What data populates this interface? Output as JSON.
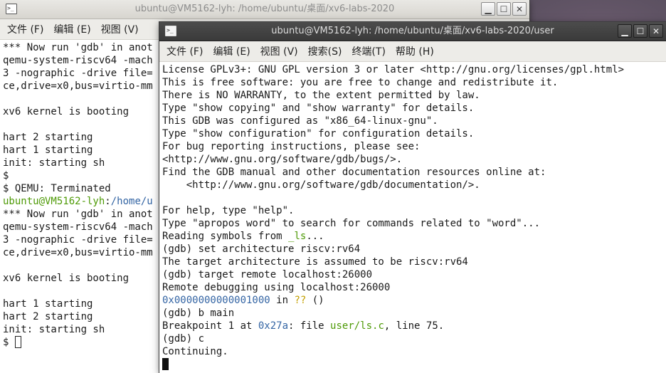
{
  "back_window": {
    "title": "ubuntu@VM5162-lyh: /home/ubuntu/桌面/xv6-labs-2020",
    "menu": [
      "文件 (F)",
      "编辑 (E)",
      "视图 (V)"
    ],
    "lines": [
      [
        {
          "t": "*** Now run 'gdb' in anot"
        }
      ],
      [
        {
          "t": "qemu-system-riscv64 -mach"
        }
      ],
      [
        {
          "t": "3 -nographic -drive file="
        }
      ],
      [
        {
          "t": "ce,drive=x0,bus=virtio-mm"
        }
      ],
      [
        {
          "t": ""
        }
      ],
      [
        {
          "t": "xv6 kernel is booting"
        }
      ],
      [
        {
          "t": ""
        }
      ],
      [
        {
          "t": "hart 2 starting"
        }
      ],
      [
        {
          "t": "hart 1 starting"
        }
      ],
      [
        {
          "t": "init: starting sh"
        }
      ],
      [
        {
          "t": "$"
        }
      ],
      [
        {
          "t": "$ QEMU: Terminated"
        }
      ],
      [
        {
          "t": "ubuntu@VM5162-lyh",
          "c": "green"
        },
        {
          "t": ":"
        },
        {
          "t": "/home/u",
          "c": "blue"
        }
      ],
      [
        {
          "t": "*** Now run 'gdb' in anot"
        }
      ],
      [
        {
          "t": "qemu-system-riscv64 -mach"
        }
      ],
      [
        {
          "t": "3 -nographic -drive file="
        }
      ],
      [
        {
          "t": "ce,drive=x0,bus=virtio-mm"
        }
      ],
      [
        {
          "t": ""
        }
      ],
      [
        {
          "t": "xv6 kernel is booting"
        }
      ],
      [
        {
          "t": ""
        }
      ],
      [
        {
          "t": "hart 1 starting"
        }
      ],
      [
        {
          "t": "hart 2 starting"
        }
      ],
      [
        {
          "t": "init: starting sh"
        }
      ],
      [
        {
          "t": "$ "
        }
      ]
    ]
  },
  "front_window": {
    "title": "ubuntu@VM5162-lyh: /home/ubuntu/桌面/xv6-labs-2020/user",
    "menu": [
      "文件 (F)",
      "编辑 (E)",
      "视图 (V)",
      "搜索(S)",
      "终端(T)",
      "帮助 (H)"
    ],
    "lines": [
      [
        {
          "t": "License GPLv3+: GNU GPL version 3 or later <http://gnu.org/licenses/gpl.html>"
        }
      ],
      [
        {
          "t": "This is free software: you are free to change and redistribute it."
        }
      ],
      [
        {
          "t": "There is NO WARRANTY, to the extent permitted by law."
        }
      ],
      [
        {
          "t": "Type \"show copying\" and \"show warranty\" for details."
        }
      ],
      [
        {
          "t": "This GDB was configured as \"x86_64-linux-gnu\"."
        }
      ],
      [
        {
          "t": "Type \"show configuration\" for configuration details."
        }
      ],
      [
        {
          "t": "For bug reporting instructions, please see:"
        }
      ],
      [
        {
          "t": "<http://www.gnu.org/software/gdb/bugs/>."
        }
      ],
      [
        {
          "t": "Find the GDB manual and other documentation resources online at:"
        }
      ],
      [
        {
          "t": "    <http://www.gnu.org/software/gdb/documentation/>."
        }
      ],
      [
        {
          "t": ""
        }
      ],
      [
        {
          "t": "For help, type \"help\"."
        }
      ],
      [
        {
          "t": "Type \"apropos word\" to search for commands related to \"word\"..."
        }
      ],
      [
        {
          "t": "Reading symbols from "
        },
        {
          "t": "_ls",
          "c": "green"
        },
        {
          "t": "..."
        }
      ],
      [
        {
          "t": "(gdb) set architecture riscv:rv64"
        }
      ],
      [
        {
          "t": "The target architecture is assumed to be riscv:rv64"
        }
      ],
      [
        {
          "t": "(gdb) target remote localhost:26000"
        }
      ],
      [
        {
          "t": "Remote debugging using localhost:26000"
        }
      ],
      [
        {
          "t": "0x0000000000001000",
          "c": "blue"
        },
        {
          "t": " in "
        },
        {
          "t": "??",
          "c": "yellow"
        },
        {
          "t": " ()"
        }
      ],
      [
        {
          "t": "(gdb) b main"
        }
      ],
      [
        {
          "t": "Breakpoint 1 at "
        },
        {
          "t": "0x27a",
          "c": "blue"
        },
        {
          "t": ": file "
        },
        {
          "t": "user/ls.c",
          "c": "green"
        },
        {
          "t": ", line 75."
        }
      ],
      [
        {
          "t": "(gdb) c"
        }
      ],
      [
        {
          "t": "Continuing."
        }
      ],
      [
        {
          "t": ""
        }
      ]
    ]
  }
}
